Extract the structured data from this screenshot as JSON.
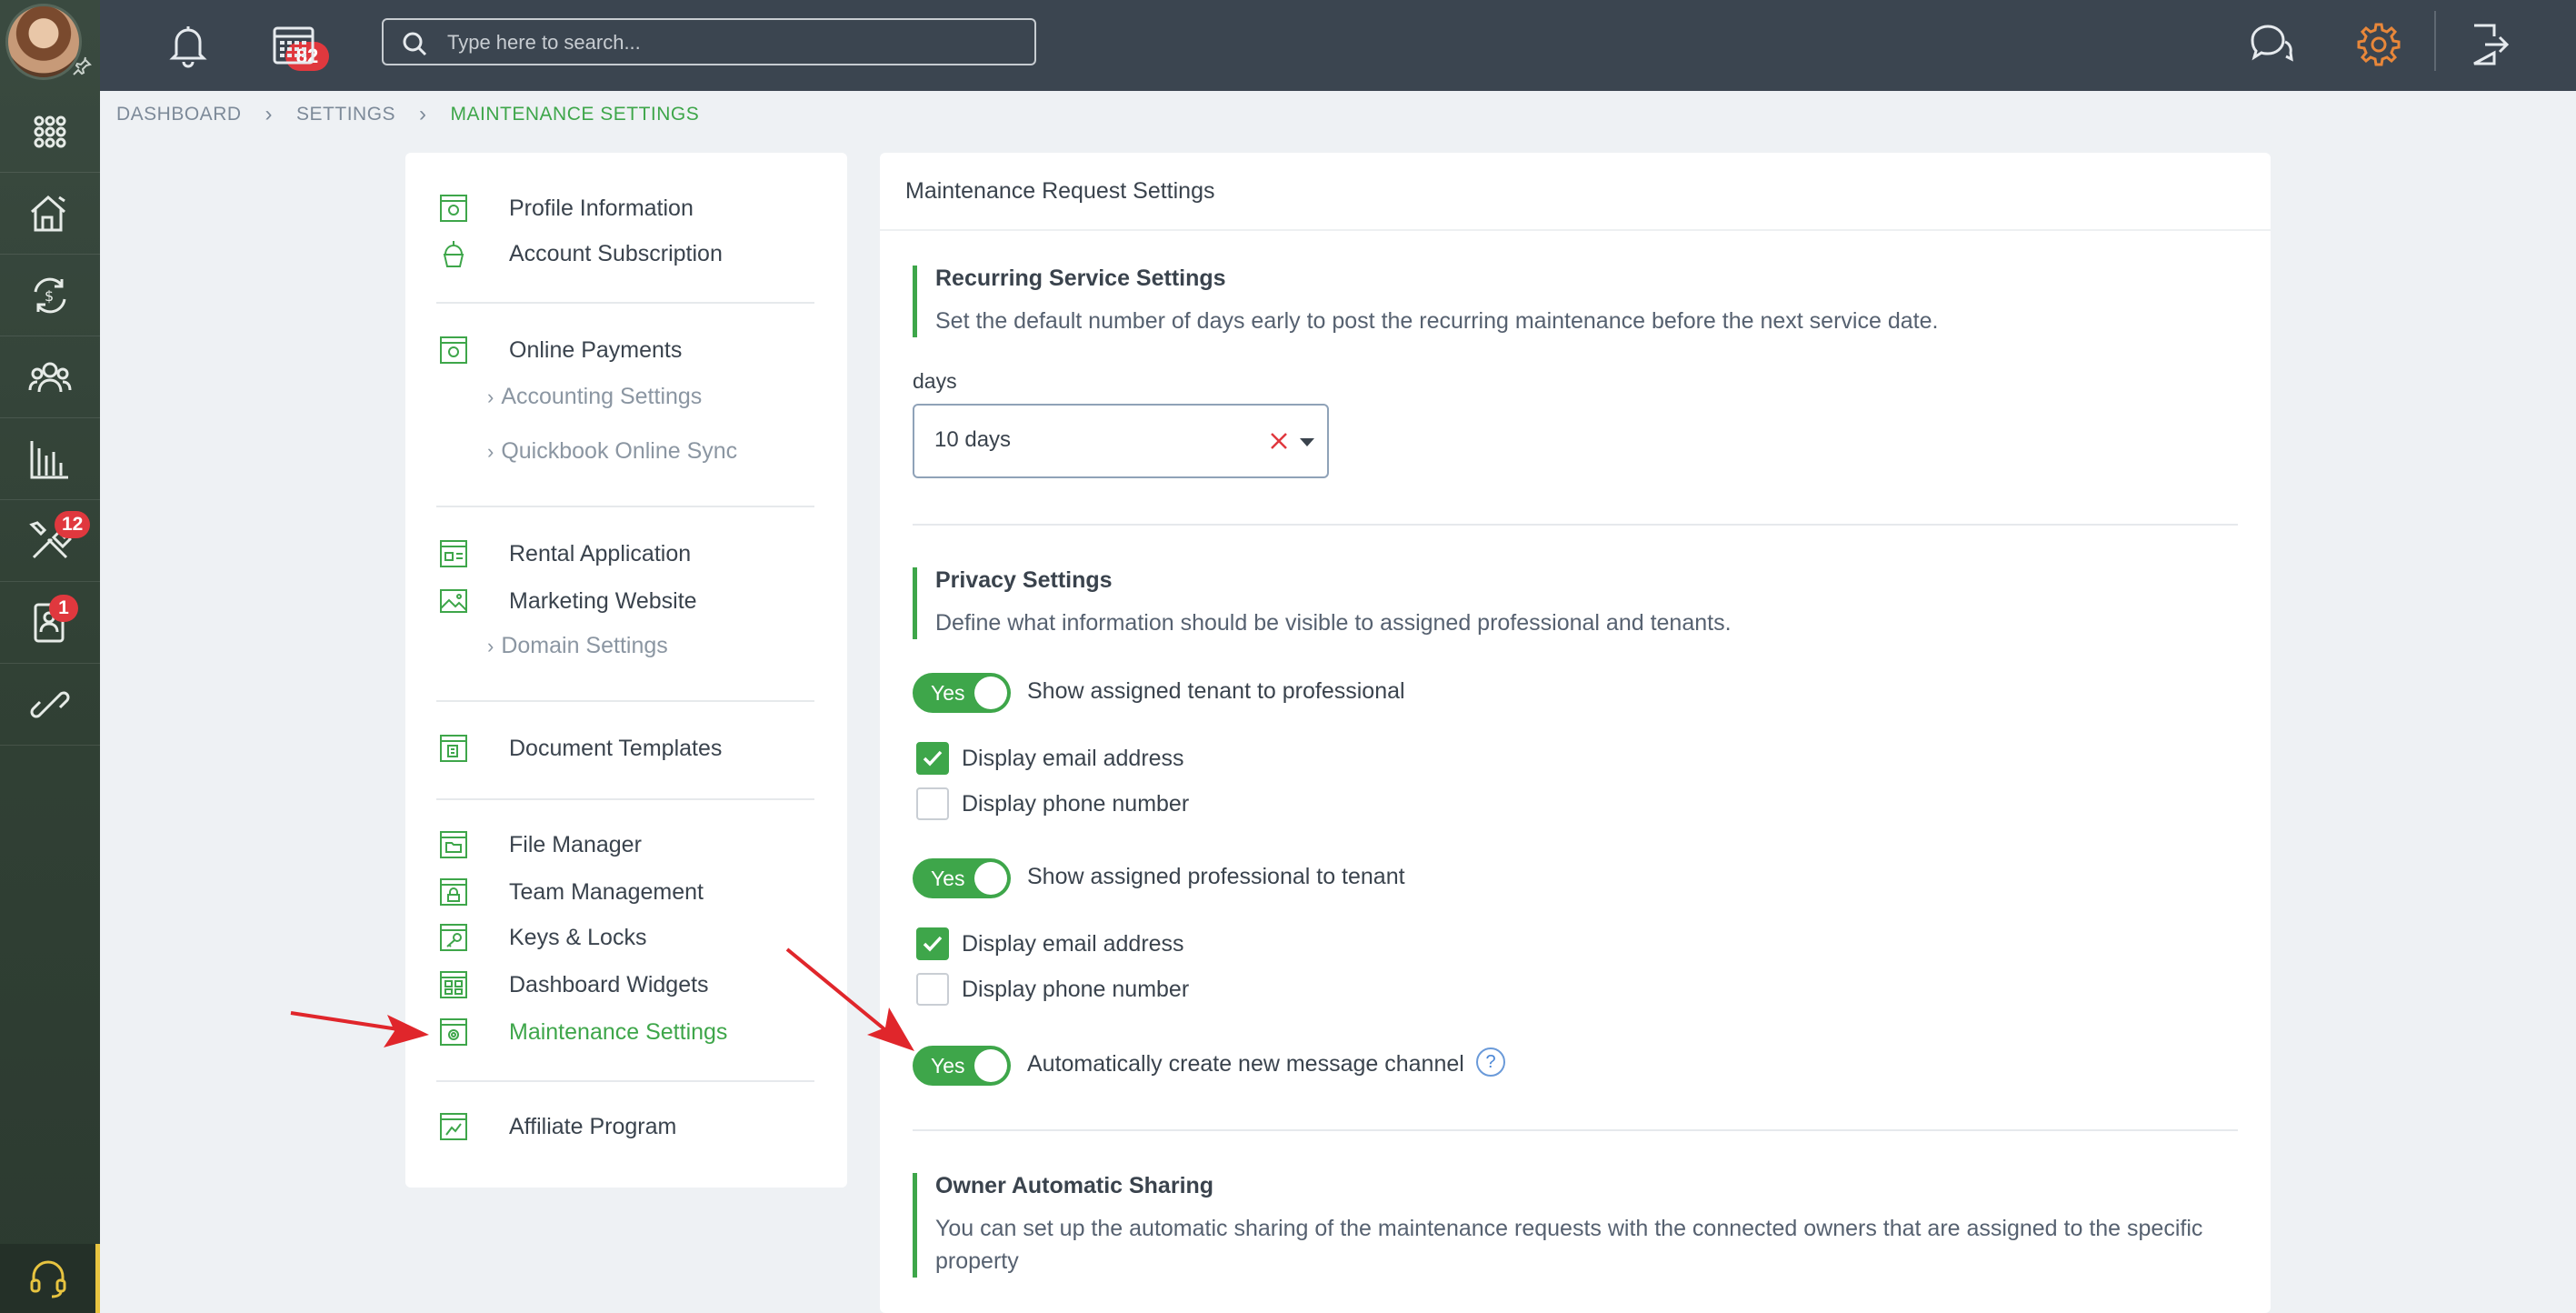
{
  "rail": {
    "items": [
      {
        "name": "apps-grid-icon"
      },
      {
        "name": "properties-icon"
      },
      {
        "name": "payments-icon"
      },
      {
        "name": "contacts-icon"
      },
      {
        "name": "reports-icon"
      },
      {
        "name": "maintenance-icon",
        "badge": "12"
      },
      {
        "name": "tenant-screening-icon",
        "badge": "1"
      },
      {
        "name": "integrations-icon"
      }
    ]
  },
  "topbar": {
    "notifications_count": "82",
    "search_placeholder": "Type here to search..."
  },
  "breadcrumb": {
    "items": [
      "DASHBOARD",
      "SETTINGS"
    ],
    "current": "MAINTENANCE SETTINGS"
  },
  "menu": {
    "profile": "Profile Information",
    "subscription": "Account Subscription",
    "online_payments": "Online Payments",
    "accounting": "Accounting Settings",
    "quickbook": "Quickbook Online Sync",
    "rental_app": "Rental Application",
    "marketing": "Marketing Website",
    "domain": "Domain Settings",
    "documents": "Document Templates",
    "file_manager": "File Manager",
    "team": "Team Management",
    "keys": "Keys & Locks",
    "widgets": "Dashboard Widgets",
    "maintenance": "Maintenance Settings",
    "affiliate": "Affiliate Program"
  },
  "panel": {
    "title": "Maintenance Request Settings",
    "recurring": {
      "title": "Recurring Service Settings",
      "description": "Set the default number of days early to post the recurring maintenance before the next service date.",
      "field_label": "days",
      "value": "10 days"
    },
    "privacy": {
      "title": "Privacy Settings",
      "description": "Define what information should be visible to assigned professional and tenants.",
      "toggle1": {
        "state": "Yes",
        "label": "Show assigned tenant to professional"
      },
      "t1_email": {
        "checked": true,
        "label": "Display email address"
      },
      "t1_phone": {
        "checked": false,
        "label": "Display phone number"
      },
      "toggle2": {
        "state": "Yes",
        "label": "Show assigned professional to tenant"
      },
      "t2_email": {
        "checked": true,
        "label": "Display email address"
      },
      "t2_phone": {
        "checked": false,
        "label": "Display phone number"
      },
      "toggle3": {
        "state": "Yes",
        "label": "Automatically create new message channel"
      },
      "help": "?"
    },
    "owner": {
      "title": "Owner Automatic Sharing",
      "description": "You can set up the automatic sharing of the maintenance requests with the connected owners that are assigned to the specific property"
    }
  },
  "colors": {
    "accent": "#3ea64a",
    "topbar": "#3b4550",
    "rail": "#314135",
    "badge": "#e0383e",
    "arrow": "#e0262b",
    "gear": "#e8873a"
  }
}
